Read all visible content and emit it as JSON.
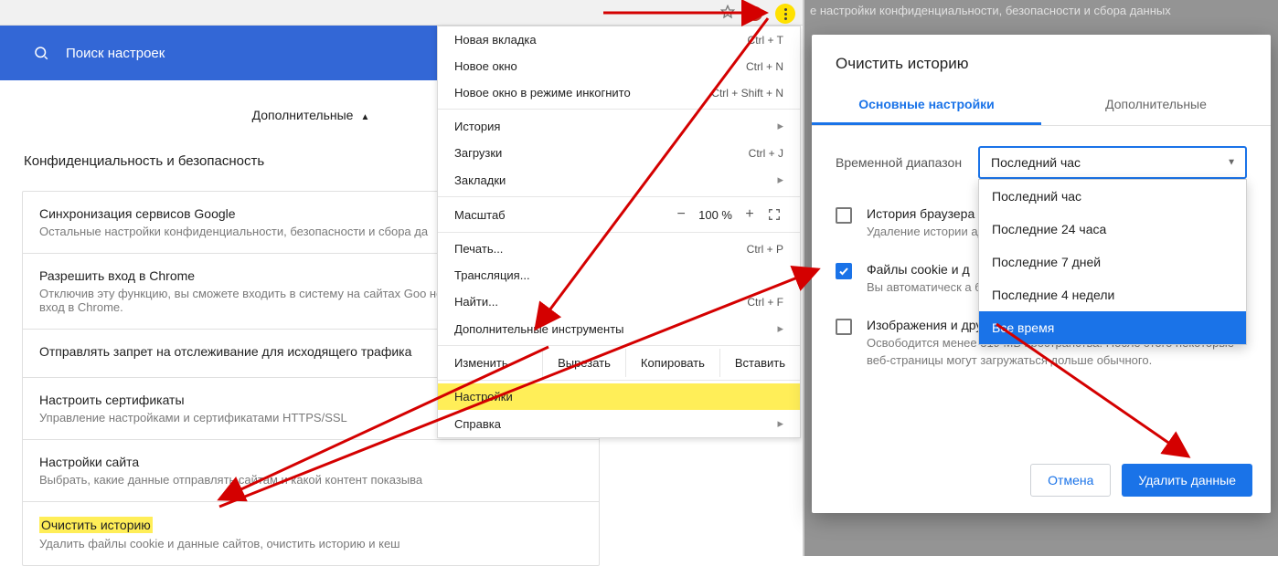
{
  "search": {
    "placeholder": "Поиск настроек"
  },
  "extra": {
    "label": "Дополнительные"
  },
  "section": {
    "title": "Конфиденциальность и безопасность"
  },
  "rows": [
    {
      "t": "Синхронизация сервисов Google",
      "d": "Остальные настройки конфиденциальности, безопасности и сбора да"
    },
    {
      "t": "Разрешить вход в Chrome",
      "d": "Отключив эту функцию, вы сможете входить в систему на сайтах Goo необходимости выполнять вход в Chrome."
    },
    {
      "t": "Отправлять запрет на отслеживание для исходящего трафика",
      "d": ""
    },
    {
      "t": "Настроить сертификаты",
      "d": "Управление настройками и сертификатами HTTPS/SSL"
    },
    {
      "t": "Настройки сайта",
      "d": "Выбрать, какие данные отправлять сайтам и какой контент показыва"
    },
    {
      "t": "Очистить историю",
      "d": "Удалить файлы cookie и данные сайтов, очистить историю и кеш"
    }
  ],
  "menu": {
    "new_tab": "Новая вкладка",
    "new_tab_sc": "Ctrl + T",
    "new_win": "Новое окно",
    "new_win_sc": "Ctrl + N",
    "incog": "Новое окно в режиме инкогнито",
    "incog_sc": "Ctrl + Shift + N",
    "history": "История",
    "downloads": "Загрузки",
    "downloads_sc": "Ctrl + J",
    "bookmarks": "Закладки",
    "zoom_lbl": "Масштаб",
    "zoom_val": "100 %",
    "print": "Печать...",
    "print_sc": "Ctrl + P",
    "cast": "Трансляция...",
    "find": "Найти...",
    "find_sc": "Ctrl + F",
    "moretools": "Дополнительные инструменты",
    "edit": "Изменить",
    "cut": "Вырезать",
    "copy": "Копировать",
    "paste": "Вставить",
    "settings": "Настройки",
    "help": "Справка"
  },
  "shade_text": "е настройки конфиденциальности, безопасности и сбора данных",
  "dialog": {
    "title": "Очистить историю",
    "tab_basic": "Основные настройки",
    "tab_adv": "Дополнительные",
    "range_label": "Временной диапазон",
    "range_value": "Последний час",
    "options": [
      "Последний час",
      "Последние 24 часа",
      "Последние 7 дней",
      "Последние 4 недели",
      "Все время"
    ],
    "ck1_t": "История браузера",
    "ck1_d": "Удаление истории                                                           адресной строке",
    "ck2_t": "Файлы cookie и д",
    "ck2_d": "Вы автоматическ                                                             а большинстве сайтов.",
    "ck3_t": "Изображения и другие файлы, сохраненные в кеше",
    "ck3_d": "Освободится менее 319 МБ пространства. После этого некоторые веб-страницы могут загружаться дольше обычного.",
    "cancel": "Отмена",
    "clear": "Удалить данные"
  }
}
